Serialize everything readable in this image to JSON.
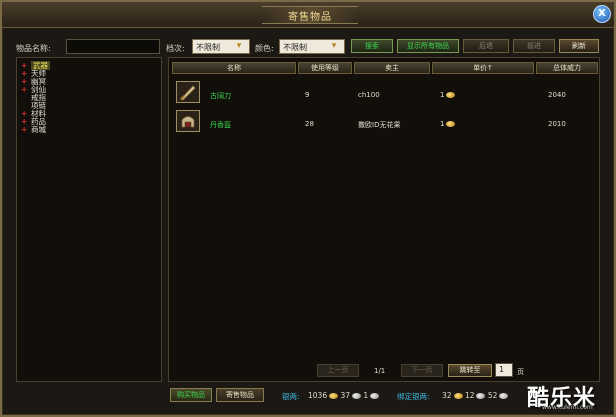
{
  "window": {
    "title": "寄售物品"
  },
  "search": {
    "name_label": "物品名称:",
    "name_value": "",
    "level_label": "档次:",
    "level_value": "不限制",
    "color_label": "颜色:",
    "color_value": "不限制"
  },
  "toolbar": {
    "search": "搜索",
    "show_all": "显示所有物品",
    "back": "后退",
    "forward": "前进",
    "refresh": "刷新"
  },
  "categories": [
    {
      "label": "武器",
      "expandable": true,
      "selected": true
    },
    {
      "label": "天师",
      "expandable": true,
      "selected": false
    },
    {
      "label": "幽冥",
      "expandable": true,
      "selected": false
    },
    {
      "label": "剑仙",
      "expandable": true,
      "selected": false
    },
    {
      "label": "戒指",
      "expandable": false,
      "selected": false
    },
    {
      "label": "项链",
      "expandable": false,
      "selected": false
    },
    {
      "label": "材料",
      "expandable": true,
      "selected": false
    },
    {
      "label": "药品",
      "expandable": true,
      "selected": false
    },
    {
      "label": "商城",
      "expandable": true,
      "selected": false
    }
  ],
  "table": {
    "headers": [
      "名称",
      "使用等级",
      "卖主",
      "单价↑",
      "总体威力"
    ],
    "rows": [
      {
        "name": "古阔刀",
        "level": "9",
        "seller": "ch100",
        "price": "1",
        "power": "2040",
        "icon": "sword-icon"
      },
      {
        "name": "丹香盔",
        "level": "28",
        "seller": "撒欧ID无花果",
        "price": "1",
        "power": "2010",
        "icon": "helmet-icon"
      }
    ]
  },
  "pager": {
    "prev": "上一页",
    "page_info": "1/1",
    "next": "下一页",
    "jump": "跳转至",
    "page_input": "1",
    "page_unit": "页"
  },
  "bottom": {
    "tab_buy": "购买物品",
    "tab_sell": "寄售物品",
    "silver_label": "银两:",
    "silver_1": "1036",
    "silver_2": "37",
    "silver_3": "1",
    "bound_label": "绑定银两:",
    "bound_1": "32",
    "bound_2": "12",
    "bound_3": "52"
  },
  "watermark": {
    "main": "酷乐米",
    "sub": "www.kulemi.com"
  },
  "colors": {
    "accent_green": "#3cd850",
    "gold": "#f0d890",
    "money_blue": "#3ab8e0"
  }
}
